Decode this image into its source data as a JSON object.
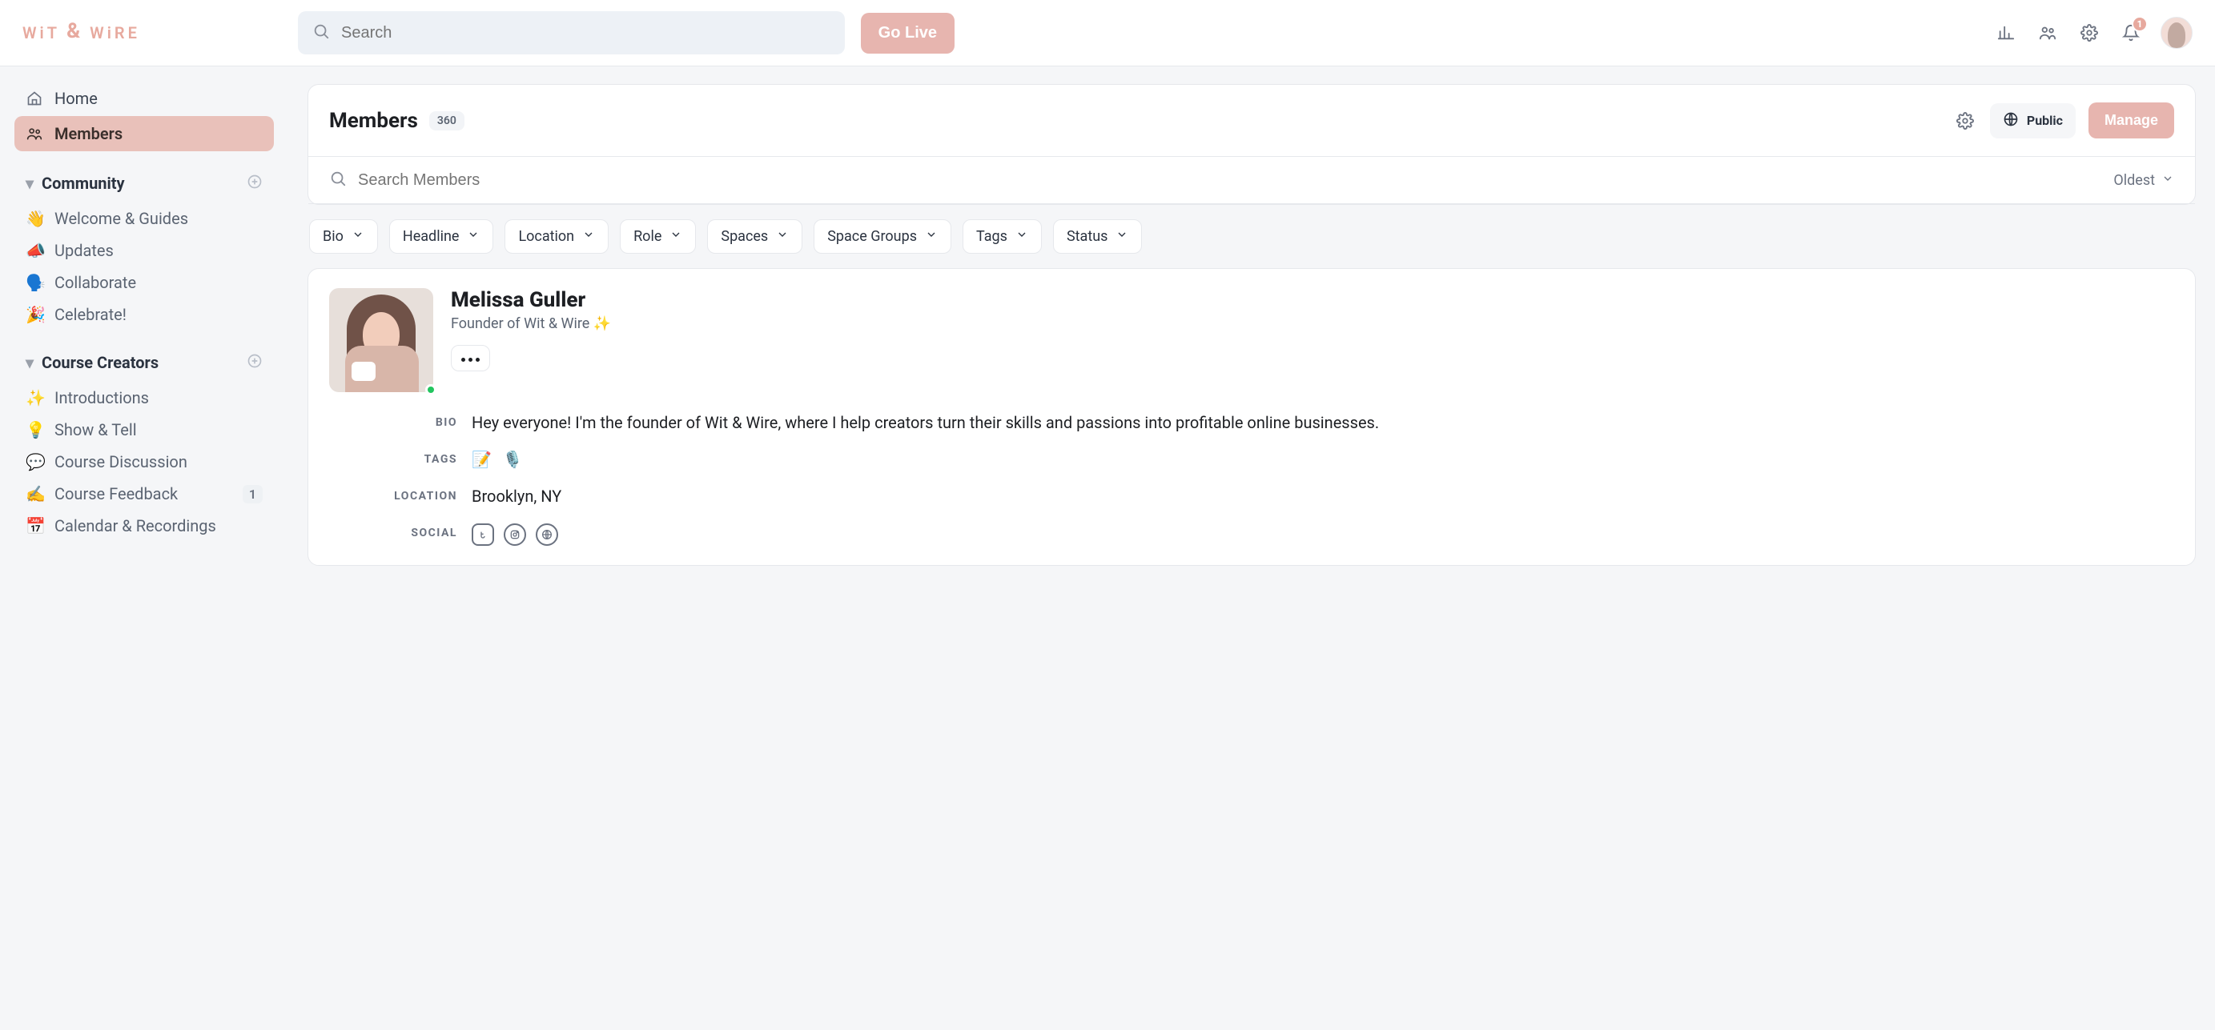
{
  "brand": {
    "left": "WiT",
    "amp": "&",
    "right": "WiRE"
  },
  "topbar": {
    "search_placeholder": "Search",
    "go_live": "Go Live",
    "notifications": "1"
  },
  "sidebar": {
    "home": "Home",
    "members": "Members",
    "community_title": "Community",
    "community_items": [
      {
        "emoji": "👋",
        "label": "Welcome & Guides"
      },
      {
        "emoji": "📣",
        "label": "Updates"
      },
      {
        "emoji": "🗣️",
        "label": "Collaborate"
      },
      {
        "emoji": "🎉",
        "label": "Celebrate!"
      }
    ],
    "creators_title": "Course Creators",
    "creators_items": [
      {
        "emoji": "✨",
        "label": "Introductions"
      },
      {
        "emoji": "💡",
        "label": "Show & Tell"
      },
      {
        "emoji": "💬",
        "label": "Course Discussion"
      },
      {
        "emoji": "✍️",
        "label": "Course Feedback",
        "count": "1"
      },
      {
        "emoji": "📅",
        "label": "Calendar & Recordings"
      }
    ]
  },
  "page": {
    "title": "Members",
    "count": "360",
    "visibility": "Public",
    "manage": "Manage",
    "search_placeholder": "Search Members",
    "sort_label": "Oldest",
    "filters": [
      "Bio",
      "Headline",
      "Location",
      "Role",
      "Spaces",
      "Space Groups",
      "Tags",
      "Status"
    ]
  },
  "member": {
    "name": "Melissa Guller",
    "headline": "Founder of Wit & Wire ✨",
    "labels": {
      "bio": "BIO",
      "tags": "TAGS",
      "location": "LOCATION",
      "social": "SOCIAL"
    },
    "bio": "Hey everyone! I'm the founder of Wit & Wire, where I help creators turn their skills and passions into profitable online businesses.",
    "tags": [
      "📝",
      "🎙️"
    ],
    "location": "Brooklyn, NY"
  }
}
